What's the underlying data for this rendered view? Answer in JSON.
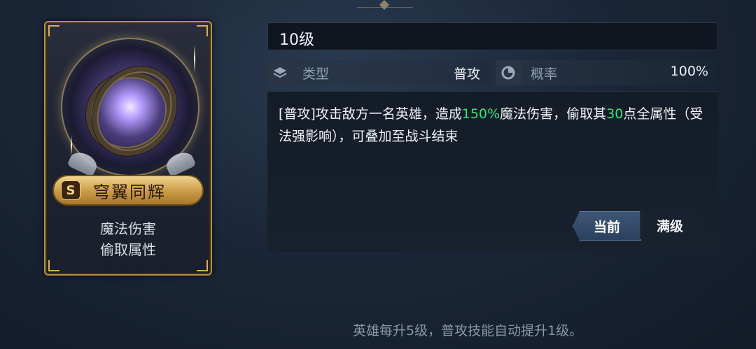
{
  "card": {
    "rank": "S",
    "skill_name": "穹翼同辉",
    "desc_line1": "魔法伤害",
    "desc_line2": "偷取属性"
  },
  "level": "10级",
  "stats": {
    "type_label": "类型",
    "type_value": "普攻",
    "rate_label": "概率",
    "rate_value": "100%"
  },
  "description": {
    "part1": "[普攻]攻击敌方一名英雄，造成",
    "highlight1": "150%",
    "part2": "魔法伤害，偷取其",
    "highlight2": "30",
    "part3": "点全属性（受法强影响），可叠加至战斗结束"
  },
  "buttons": {
    "current": "当前",
    "max": "满级"
  },
  "footer": "英雄每升5级，普攻技能自动提升1级。",
  "colors": {
    "highlight": "#3ee07a",
    "card_border": "#b8913f",
    "name_plate": "#d9b060"
  }
}
